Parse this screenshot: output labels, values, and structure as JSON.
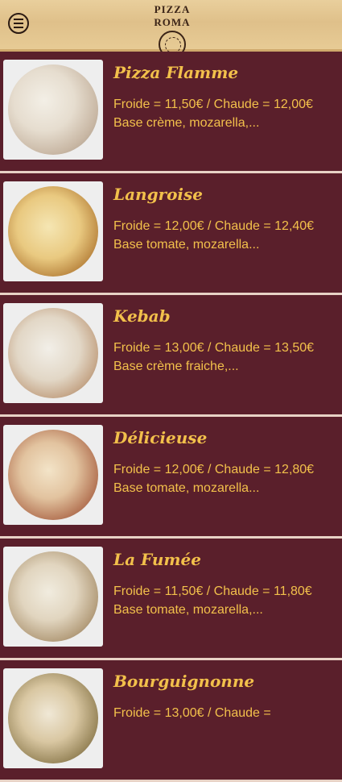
{
  "header": {
    "logo_text": "PIZZA ROMA"
  },
  "colors": {
    "background": "#5a1f2b",
    "accent": "#f2c04b",
    "divider": "#e8d2c6"
  },
  "items": [
    {
      "name": "Pizza Flamme",
      "description": "Froide = 11,50€ / Chaude = 12,00€ Base crème, mozarella,..."
    },
    {
      "name": "Langroise",
      "description": "Froide = 12,00€ / Chaude = 12,40€ Base tomate, mozarella..."
    },
    {
      "name": "Kebab",
      "description": "Froide = 13,00€ / Chaude = 13,50€ Base crème fraiche,..."
    },
    {
      "name": "Délicieuse",
      "description": "Froide = 12,00€ / Chaude = 12,80€ Base tomate, mozarella..."
    },
    {
      "name": "La Fumée",
      "description": "Froide = 11,50€ / Chaude = 11,80€ Base tomate, mozarella,..."
    },
    {
      "name": "Bourguignonne",
      "description": "Froide = 13,00€ / Chaude ="
    }
  ]
}
